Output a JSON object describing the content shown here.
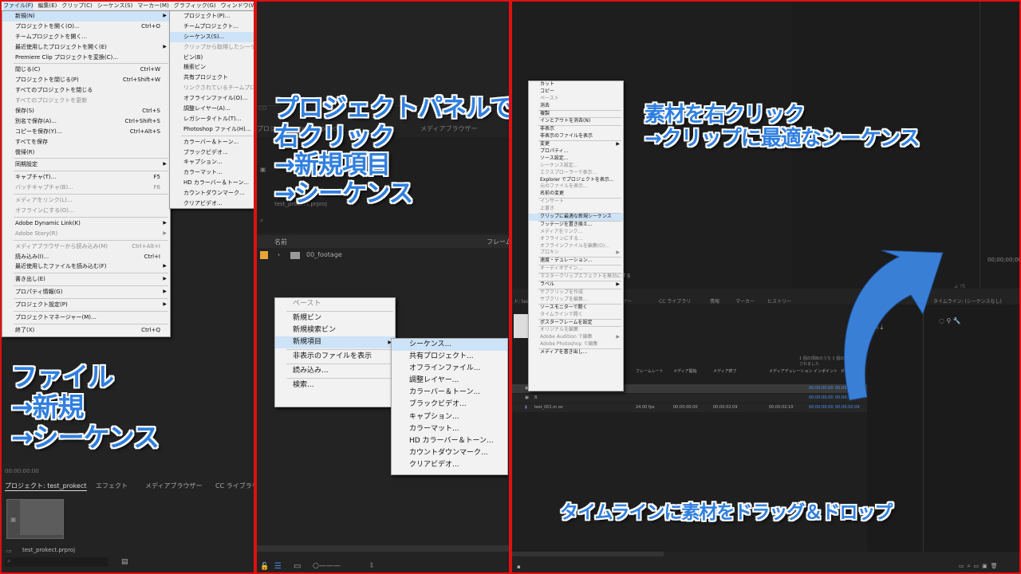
{
  "panel1": {
    "menubar": [
      "ファイル(F)",
      "編集(E)",
      "クリップ(C)",
      "シーケンス(S)",
      "マーカー(M)",
      "グラフィック(G)",
      "ウィンドウ(W)",
      "ヘルプ(H)"
    ],
    "file_menu": [
      {
        "label": "新規(N)",
        "arrow": true,
        "hl": true
      },
      {
        "label": "プロジェクトを開く(O)...",
        "sc": "Ctrl+O"
      },
      {
        "label": "チームプロジェクトを開く..."
      },
      {
        "label": "最近使用したプロジェクトを開く(E)",
        "arrow": true
      },
      {
        "label": "Premiere Clip プロジェクトを変換(C)..."
      },
      {
        "sep": true
      },
      {
        "label": "閉じる(C)",
        "sc": "Ctrl+W"
      },
      {
        "label": "プロジェクトを閉じる(P)",
        "sc": "Ctrl+Shift+W"
      },
      {
        "label": "すべてのプロジェクトを閉じる"
      },
      {
        "label": "すべてのプロジェクトを更新",
        "dis": true
      },
      {
        "label": "保存(S)",
        "sc": "Ctrl+S"
      },
      {
        "label": "別名で保存(A)...",
        "sc": "Ctrl+Shift+S"
      },
      {
        "label": "コピーを保存(Y)...",
        "sc": "Ctrl+Alt+S"
      },
      {
        "label": "すべてを保存"
      },
      {
        "label": "復帰(R)"
      },
      {
        "sep": true
      },
      {
        "label": "同期設定",
        "arrow": true
      },
      {
        "sep": true
      },
      {
        "label": "キャプチャ(T)...",
        "sc": "F5"
      },
      {
        "label": "バッチキャプチャ(B)...",
        "sc": "F6",
        "dis": true
      },
      {
        "sep": true
      },
      {
        "label": "メディアをリンク(L)...",
        "dis": true
      },
      {
        "label": "オフラインにする(O)...",
        "dis": true
      },
      {
        "sep": true
      },
      {
        "label": "Adobe Dynamic Link(K)",
        "arrow": true
      },
      {
        "label": "Adobe Story(R)",
        "arrow": true,
        "dis": true
      },
      {
        "sep": true
      },
      {
        "label": "メディアブラウザーから読み込み(M)",
        "sc": "Ctrl+Alt+I",
        "dis": true
      },
      {
        "label": "読み込み(I)...",
        "sc": "Ctrl+I"
      },
      {
        "label": "最近使用したファイルを読み込む(F)",
        "arrow": true
      },
      {
        "sep": true
      },
      {
        "label": "書き出し(E)",
        "arrow": true
      },
      {
        "sep": true
      },
      {
        "label": "プロパティ情報(G)",
        "arrow": true
      },
      {
        "sep": true
      },
      {
        "label": "プロジェクト設定(P)",
        "arrow": true
      },
      {
        "sep": true
      },
      {
        "label": "プロジェクトマネージャー(M)..."
      },
      {
        "sep": true
      },
      {
        "label": "終了(X)",
        "sc": "Ctrl+Q"
      }
    ],
    "new_submenu": [
      {
        "label": "プロジェクト(P)..."
      },
      {
        "label": "チームプロジェクト..."
      },
      {
        "label": "シーケンス(S)...",
        "hl": true
      },
      {
        "label": "クリップから取得したシーケンス",
        "dis": true
      },
      {
        "label": "ビン(B)"
      },
      {
        "label": "検索ビン"
      },
      {
        "label": "共有プロジェクト"
      },
      {
        "label": "リンクされているチームプロジェクト",
        "dis": true
      },
      {
        "label": "オフラインファイル(O)..."
      },
      {
        "label": "調整レイヤー(A)..."
      },
      {
        "label": "レガシータイトル(T)..."
      },
      {
        "label": "Photoshop ファイル(H)..."
      },
      {
        "sep": true
      },
      {
        "label": "カラーバー＆トーン..."
      },
      {
        "label": "ブラックビデオ..."
      },
      {
        "label": "キャプション..."
      },
      {
        "label": "カラーマット..."
      },
      {
        "label": "HD カラーバー＆トーン..."
      },
      {
        "label": "カウントダウンマーク..."
      },
      {
        "label": "クリアビデオ..."
      }
    ],
    "timecode": "00:00:00:00",
    "tabs": [
      "プロジェクト: test_prokect",
      "エフェクト",
      "メディアブラウザー",
      "CC ライブラリ"
    ],
    "project_file": "test_prokect.prproj",
    "caption": "ファイル\n→新規\n→シーケンス"
  },
  "panel2": {
    "bg_tabs": [
      "プロジェクト: test_prokect",
      "ト",
      "メディアブラウザー"
    ],
    "bin_label": "test_prokect.prproj",
    "col_name": "名前",
    "col_frame": "フレーム",
    "folder": "00_footage",
    "context_menu": [
      {
        "label": "ペースト",
        "dis": true
      },
      {
        "sep": true
      },
      {
        "label": "新規ビン"
      },
      {
        "label": "新規検索ビン"
      },
      {
        "label": "新規項目",
        "arrow": true,
        "hl": true
      },
      {
        "sep": true
      },
      {
        "label": "非表示のファイルを表示"
      },
      {
        "sep": true
      },
      {
        "label": "読み込み..."
      },
      {
        "sep": true
      },
      {
        "label": "検索..."
      }
    ],
    "new_item_submenu": [
      {
        "label": "シーケンス...",
        "hl": true
      },
      {
        "label": "共有プロジェクト..."
      },
      {
        "label": "オフラインファイル..."
      },
      {
        "label": "調整レイヤー..."
      },
      {
        "label": "カラーバー＆トーン..."
      },
      {
        "label": "ブラックビデオ..."
      },
      {
        "label": "キャプション..."
      },
      {
        "label": "カラーマット..."
      },
      {
        "label": "HD カラーバー＆トーン..."
      },
      {
        "label": "カウントダウンマーク..."
      },
      {
        "label": "クリアビデオ..."
      }
    ],
    "caption": "プロジェクトパネルで\n右クリック\n→新規項目\n→シーケンス"
  },
  "panel3": {
    "context_menu": [
      {
        "label": "カット"
      },
      {
        "label": "コピー"
      },
      {
        "label": "ペースト",
        "dis": true
      },
      {
        "label": "消去"
      },
      {
        "sep": true
      },
      {
        "label": "複製"
      },
      {
        "sep": true
      },
      {
        "label": "インとアウトを消去(N)"
      },
      {
        "sep": true
      },
      {
        "label": "非表示"
      },
      {
        "label": "非表示のファイルを表示"
      },
      {
        "sep": true
      },
      {
        "label": "変更",
        "arrow": true
      },
      {
        "label": "プロパティ..."
      },
      {
        "label": "ソース設定..."
      },
      {
        "label": "シーケンス設定...",
        "dis": true
      },
      {
        "label": "エクスプローラーで表示...",
        "dis": true
      },
      {
        "label": "Explorer でプロジェクトを表示..."
      },
      {
        "label": "元のファイルを表示...",
        "dis": true
      },
      {
        "label": "名前の変更"
      },
      {
        "sep": true
      },
      {
        "label": "インサート",
        "dis": true
      },
      {
        "label": "上書き",
        "dis": true
      },
      {
        "sep": true
      },
      {
        "label": "クリップに最適な新規シーケンス",
        "hl": true
      },
      {
        "sep": true
      },
      {
        "label": "フッテージを置き換え..."
      },
      {
        "label": "メディアをリンク...",
        "dis": true
      },
      {
        "label": "オフラインにする...",
        "dis": true
      },
      {
        "label": "オフラインファイルを編集(O)...",
        "dis": true
      },
      {
        "label": "プロキシ",
        "arrow": true,
        "dis": true
      },
      {
        "sep": true
      },
      {
        "label": "速度・デュレーション..."
      },
      {
        "sep": true
      },
      {
        "label": "オーディオゲイン...",
        "dis": true
      },
      {
        "sep": true
      },
      {
        "label": "マスタークリップエフェクトを無効にする",
        "dis": true
      },
      {
        "sep": true
      },
      {
        "label": "ラベル",
        "arrow": true
      },
      {
        "sep": true
      },
      {
        "label": "サブクリップを作成",
        "dis": true
      },
      {
        "label": "サブクリップを編集...",
        "dis": true
      },
      {
        "sep": true
      },
      {
        "label": "ソースモニターで開く"
      },
      {
        "label": "タイムラインで開く",
        "dis": true
      },
      {
        "sep": true
      },
      {
        "label": "ポスターフレームを設定"
      },
      {
        "sep": true
      },
      {
        "label": "オリジナルを編集",
        "dis": true
      },
      {
        "label": "Adobe Audition で編集",
        "arrow": true,
        "dis": true
      },
      {
        "label": "Adobe Photoshop で編集",
        "dis": true
      },
      {
        "sep": true
      },
      {
        "label": "メディアを書き出し..."
      }
    ],
    "bar_items": [
      "ト: test",
      "ザー",
      "CC ライブラリ",
      "情報",
      "マーカー",
      "ヒストリー",
      "タイムライン: (シーケンスなし)"
    ],
    "timecode": "00;00;00;00",
    "bin_status": "1 個の項目のうち 1 個の項目が選択されました",
    "columns": [
      "フレームレート",
      "メディア開始",
      "メディア終了",
      "メディアデュレーション",
      "インポイント",
      "ビデオアウト"
    ],
    "rows": [
      {
        "name": "",
        "rate": "",
        "start": "",
        "end": "",
        "dur": "",
        "in": "00:00:00:00",
        "out": "00:00:04:29"
      },
      {
        "name": "B",
        "rate": "",
        "start": "",
        "end": "",
        "dur": "",
        "in": "00:00:00:00",
        "out": "00:00:04:29"
      },
      {
        "name": "test_001.m ov",
        "rate": "24.00 fps",
        "start": "00:00:00:00",
        "end": "00:00:02:09",
        "dur": "00:00:02:10",
        "in": "00:00:00:00",
        "out": "00:00:02:09"
      }
    ],
    "caption_top": "素材を右クリック\n→クリップに最適なシーケンス",
    "caption_bottom": "タイムラインに素材をドラッグ＆ドロップ",
    "arrow_color": "#3a7fd6"
  },
  "colors": {
    "accent": "#2f7fe0",
    "highlight": "#cde3f7",
    "frame": "#e01010"
  }
}
